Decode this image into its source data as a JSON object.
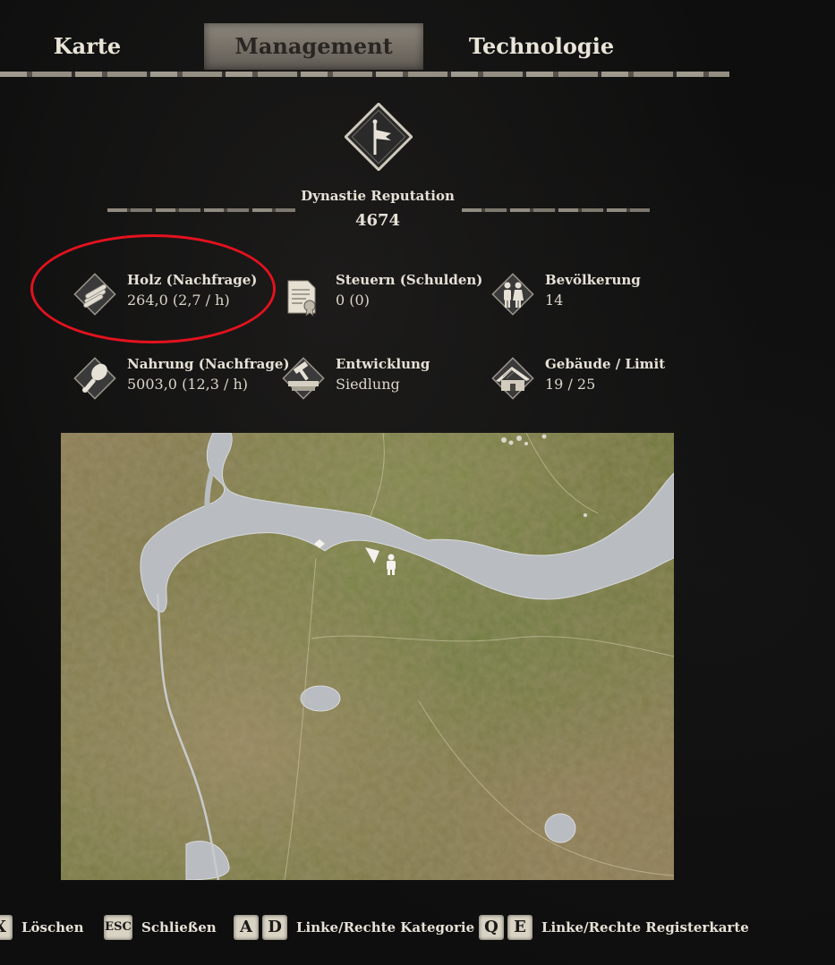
{
  "tabs": [
    {
      "label": "Karte"
    },
    {
      "label": "Management",
      "active": true
    },
    {
      "label": "Technologie"
    }
  ],
  "reputation": {
    "label": "Dynastie Reputation",
    "value": "4674",
    "icon": "flag-icon"
  },
  "stats": {
    "wood": {
      "label": "Holz (Nachfrage)",
      "value": "264,0  (2,7 / h)",
      "icon": "wood-logs-icon"
    },
    "taxes": {
      "label": "Steuern (Schulden)",
      "value": "0  (0)",
      "icon": "tax-scroll-icon"
    },
    "population": {
      "label": "Bevölkerung",
      "value": "14",
      "icon": "people-icon"
    },
    "food": {
      "label": "Nahrung (Nachfrage)",
      "value": "5003,0  (12,3 / h)",
      "icon": "food-drumstick-icon"
    },
    "development": {
      "label": "Entwicklung",
      "value": "Siedlung",
      "icon": "hammer-icon"
    },
    "buildings": {
      "label": "Gebäude / Limit",
      "value": "19 / 25",
      "icon": "house-icon"
    }
  },
  "hints": {
    "delete": {
      "key": "X",
      "label": "Löschen"
    },
    "close": {
      "key": "ESC",
      "label": "Schließen"
    },
    "category": {
      "key_left": "A",
      "key_right": "D",
      "label": "Linke/Rechte Kategorie"
    },
    "tab": {
      "key_left": "Q",
      "key_right": "E",
      "label": "Linke/Rechte Registerkarte"
    }
  },
  "colors": {
    "highlight": "#e3121e",
    "water": "#b9bcc0",
    "active_tab": "#7a746a"
  }
}
